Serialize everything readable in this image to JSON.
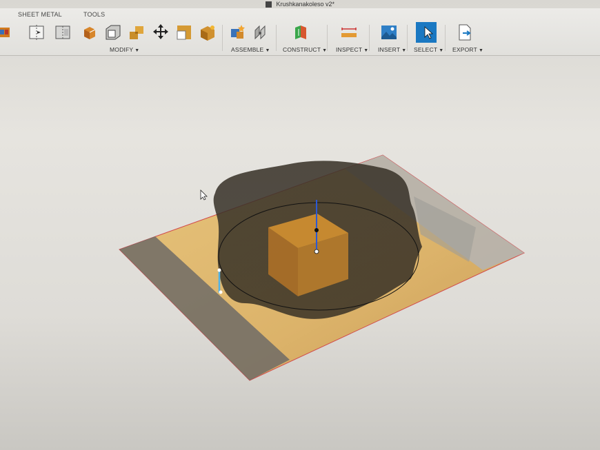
{
  "window": {
    "title": "Krushkanakoleso v2*"
  },
  "ribbon": {
    "tabs": [
      {
        "label": "SHEET METAL"
      },
      {
        "label": "TOOLS"
      }
    ],
    "groups": {
      "modify": "MODIFY",
      "assemble": "ASSEMBLE",
      "construct": "CONSTRUCT",
      "inspect": "INSPECT",
      "insert": "INSERT",
      "select": "SELECT",
      "export": "EXPORT"
    },
    "icons": [
      "box-icon",
      "split-body-icon",
      "split-face-icon",
      "press-pull-icon",
      "shell-icon",
      "combine-icon",
      "move-icon",
      "scale-icon",
      "appearance-icon",
      "new-component-icon",
      "joint-icon",
      "offset-plane-icon",
      "measure-icon",
      "insert-image-icon",
      "select-cursor-icon",
      "export-icon"
    ],
    "accent_color": "#1a78c2"
  },
  "viewport": {
    "model": "wavy knob body over sketch plane",
    "cursor_icon": "arrow-cursor-icon"
  }
}
